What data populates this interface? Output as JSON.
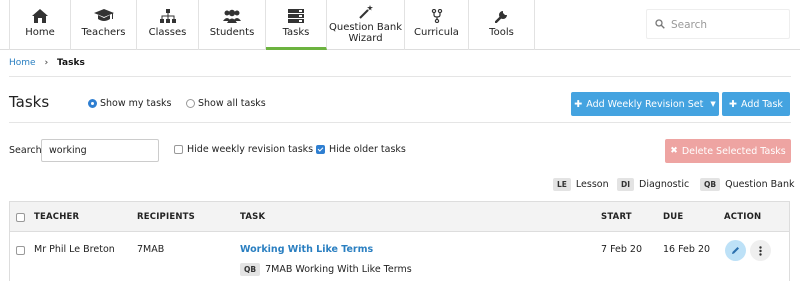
{
  "nav": {
    "items": [
      {
        "label": "Home",
        "icon": "home-icon"
      },
      {
        "label": "Teachers",
        "icon": "graduation-cap-icon"
      },
      {
        "label": "Classes",
        "icon": "sitemap-icon"
      },
      {
        "label": "Students",
        "icon": "users-icon"
      },
      {
        "label": "Tasks",
        "icon": "tasks-icon",
        "active": true
      },
      {
        "label": "Question Bank Wizard",
        "icon": "magic-wand-icon"
      },
      {
        "label": "Curricula",
        "icon": "fork-icon"
      },
      {
        "label": "Tools",
        "icon": "wrench-icon"
      }
    ],
    "search_placeholder": "Search"
  },
  "breadcrumb": {
    "home": "Home",
    "current": "Tasks"
  },
  "page": {
    "title": "Tasks",
    "show_my_tasks": "Show my tasks",
    "show_all_tasks": "Show all tasks",
    "add_weekly_revision_set": "Add Weekly Revision Set",
    "add_task": "Add Task"
  },
  "filters": {
    "search_label": "Search",
    "search_value": "working",
    "hide_weekly_revision": "Hide weekly revision tasks",
    "hide_weekly_revision_checked": false,
    "hide_older": "Hide older tasks",
    "hide_older_checked": true,
    "delete_selected": "Delete Selected Tasks"
  },
  "legend": [
    {
      "tag": "LE",
      "label": "Lesson"
    },
    {
      "tag": "DI",
      "label": "Diagnostic"
    },
    {
      "tag": "QB",
      "label": "Question Bank"
    }
  ],
  "table": {
    "headers": {
      "teacher": "TEACHER",
      "recipients": "RECIPIENTS",
      "task": "TASK",
      "start": "START",
      "due": "DUE",
      "action": "ACTION"
    },
    "rows": [
      {
        "teacher": "Mr Phil Le Breton",
        "recipients": "7MAB",
        "task": "Working With Like Terms",
        "task_tag": "QB",
        "task_sub": "7MAB Working With Like Terms",
        "start": "7 Feb 20",
        "due": "16 Feb 20"
      }
    ]
  },
  "colors": {
    "accent": "#44a3e0",
    "active_tab": "#6cb33f",
    "link": "#2a7fc1",
    "delete": "#eea4a2"
  }
}
